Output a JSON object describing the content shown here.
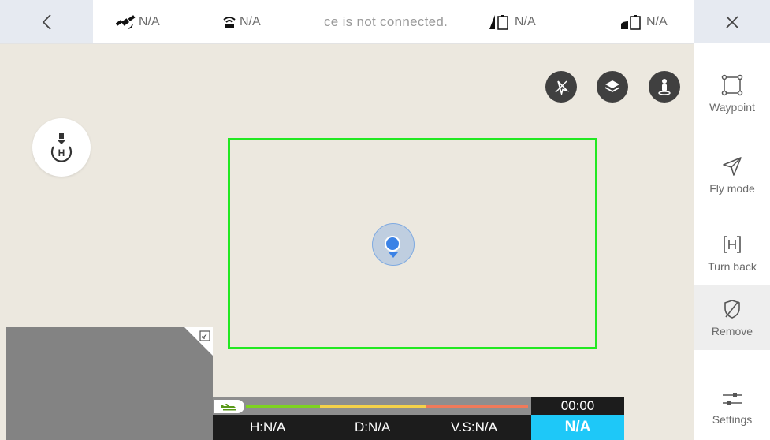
{
  "topbar": {
    "satellite_value": "N/A",
    "rc_signal_value": "N/A",
    "connection_status": "ce is not connected.",
    "aircraft_battery_value": "N/A",
    "rc_battery_value": "N/A"
  },
  "sidebar": {
    "items": [
      {
        "label": "Waypoint",
        "icon": "waypoint-square-icon"
      },
      {
        "label": "Fly mode",
        "icon": "paper-plane-icon"
      },
      {
        "label": "Turn back",
        "icon": "home-h-icon"
      },
      {
        "label": "Remove",
        "icon": "shield-slash-icon",
        "active": true
      },
      {
        "label": "Settings",
        "icon": "sliders-icon"
      }
    ]
  },
  "map_controls": [
    "compass-icon",
    "layers-icon",
    "person-location-icon"
  ],
  "telemetry": {
    "timer": "00:00",
    "height": "H:N/A",
    "distance": "D:N/A",
    "vertical_speed": "V.S:N/A",
    "mode_status": "N/A"
  },
  "colors": {
    "geofence": "#22e822",
    "accent": "#1ec8f8",
    "progress_green": "#7ed321",
    "progress_yellow": "#f5d24a",
    "progress_red": "#f07a5a"
  }
}
